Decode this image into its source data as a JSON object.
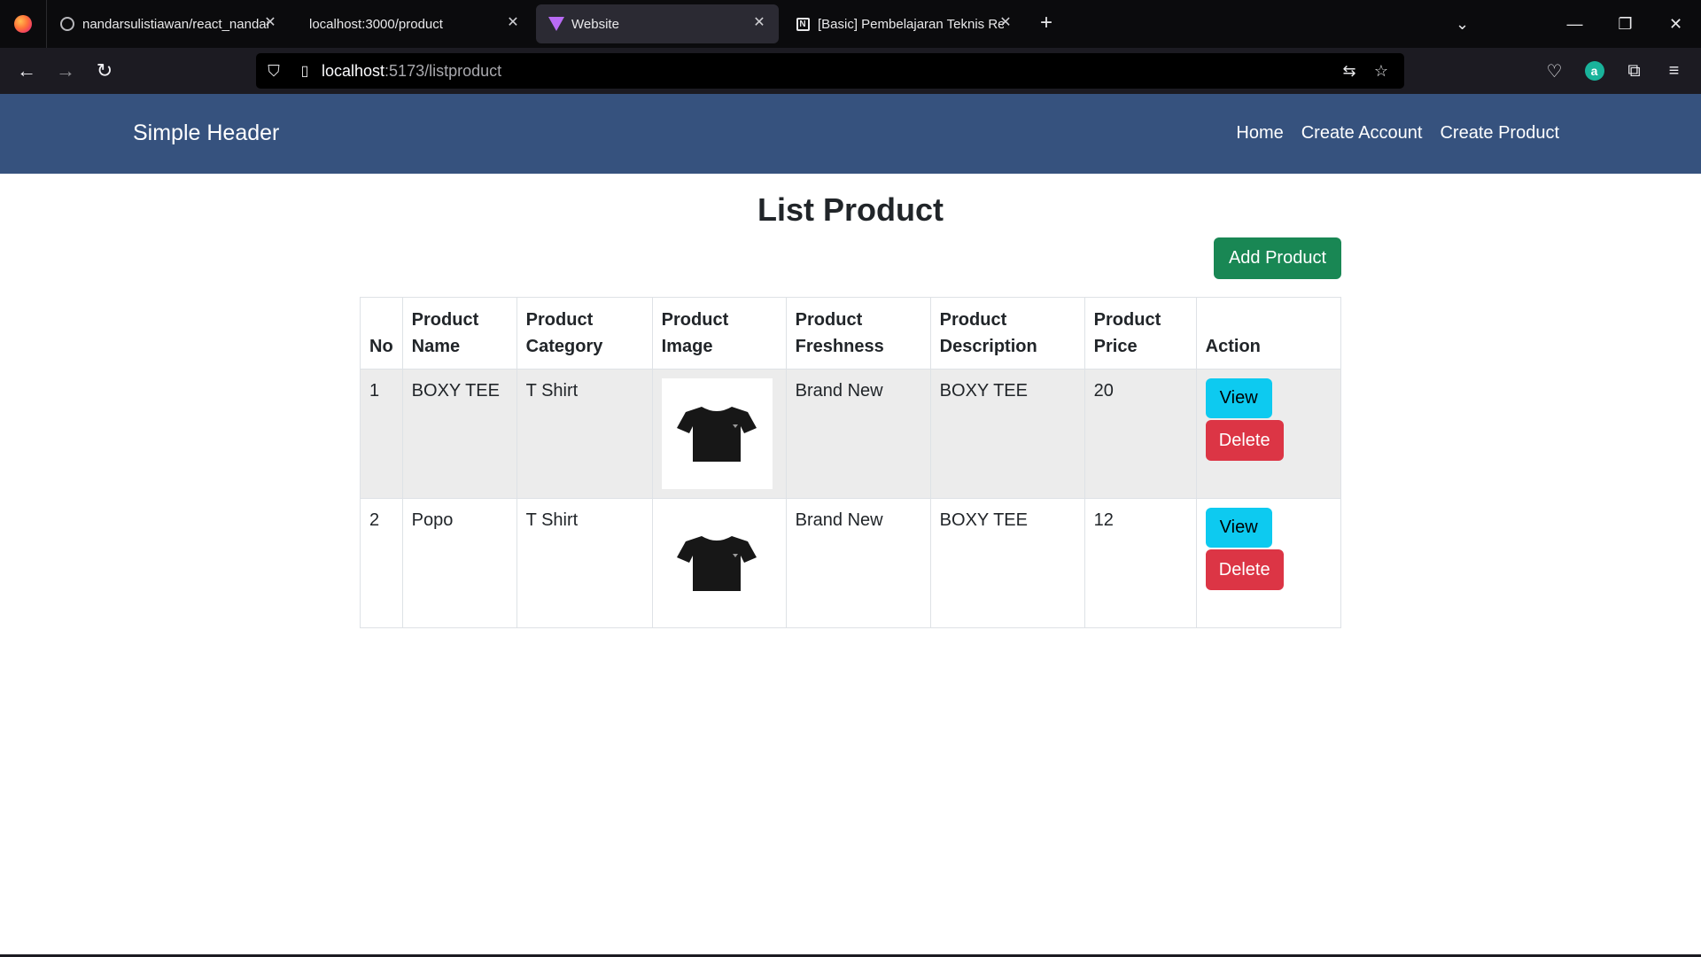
{
  "browser": {
    "tabs": [
      {
        "title": "nandarsulistiawan/react_nandar",
        "favicon": "github-icon",
        "active": false
      },
      {
        "title": "localhost:3000/product",
        "favicon": "none",
        "active": false
      },
      {
        "title": "Website",
        "favicon": "vite-icon",
        "active": true
      },
      {
        "title": "[Basic] Pembelajaran Teknis Rea",
        "favicon": "notion-icon",
        "active": false
      }
    ],
    "url_host": "localhost",
    "url_path": ":5173/listproduct"
  },
  "site": {
    "brand": "Simple Header",
    "nav": [
      "Home",
      "Create Account",
      "Create Product"
    ],
    "header_color": "#36527e"
  },
  "main": {
    "title": "List Product",
    "add_button": "Add Product",
    "columns": [
      "No",
      "Product Name",
      "Product Category",
      "Product Image",
      "Product Freshness",
      "Product Description",
      "Product Price",
      "Action"
    ],
    "rows": [
      {
        "no": "1",
        "name": "BOXY TEE",
        "category": "T Shirt",
        "image": "tshirt-image",
        "freshness": "Brand New",
        "description": "BOXY TEE",
        "price": "20"
      },
      {
        "no": "2",
        "name": "Popo",
        "category": "T Shirt",
        "image": "tshirt-image",
        "freshness": "Brand New",
        "description": "BOXY TEE",
        "price": "12"
      }
    ],
    "view_label": "View",
    "delete_label": "Delete"
  },
  "colors": {
    "success": "#198754",
    "info": "#0dcaf0",
    "danger": "#dc3545"
  }
}
